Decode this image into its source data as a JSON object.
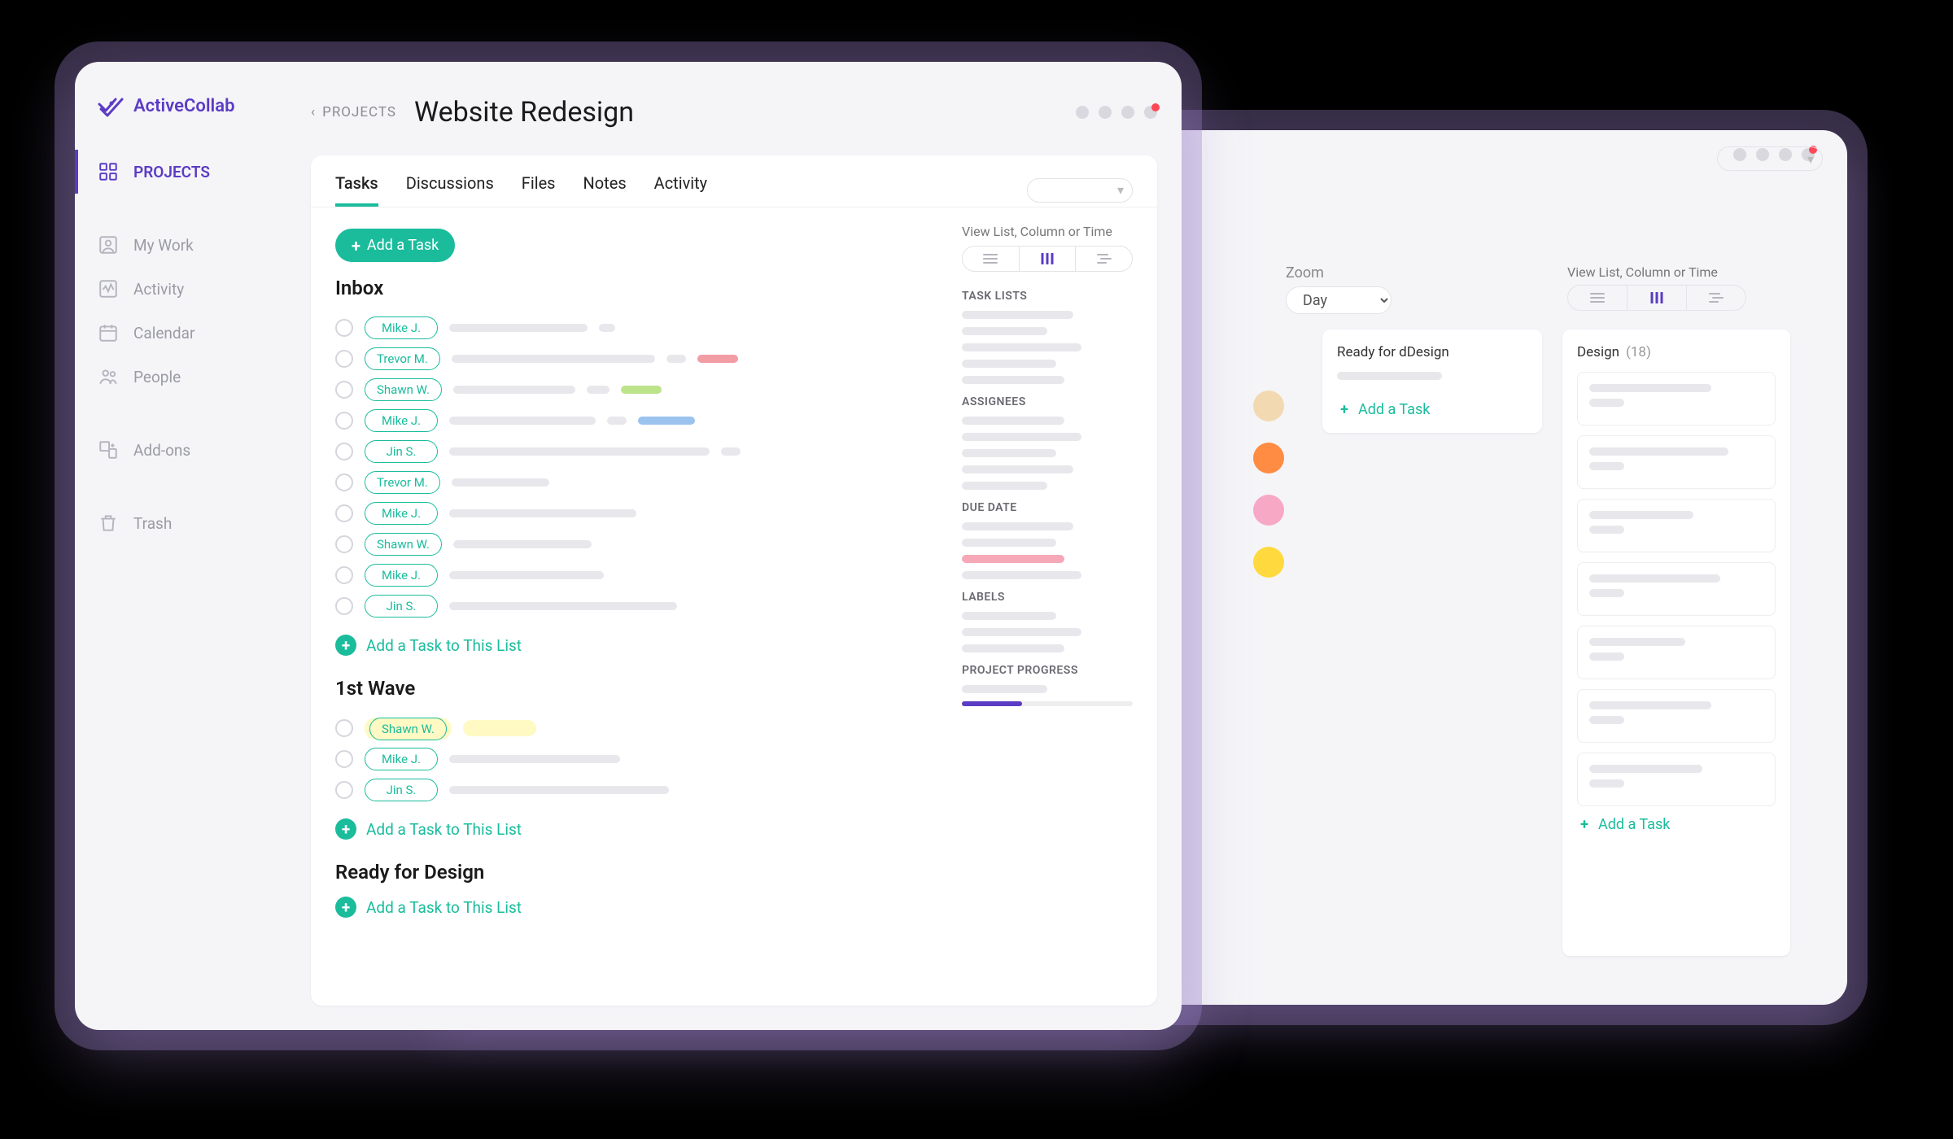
{
  "brand": "ActiveCollab",
  "breadcrumb": "PROJECTS",
  "page_title": "Website Redesign",
  "nav": {
    "projects": "PROJECTS",
    "mywork": "My Work",
    "activity": "Activity",
    "calendar": "Calendar",
    "people": "People",
    "addons": "Add-ons",
    "trash": "Trash"
  },
  "tabs": {
    "tasks": "Tasks",
    "discussions": "Discussions",
    "files": "Files",
    "notes": "Notes",
    "activity": "Activity"
  },
  "add_task_button": "Add a Task",
  "view_label": "View List, Column or Time",
  "add_to_list": "Add a Task to This List",
  "lists": {
    "inbox": "Inbox",
    "wave1": "1st Wave",
    "ready": "Ready for Design",
    "inbox_rows": [
      {
        "assignee": "Mike J."
      },
      {
        "assignee": "Trevor M."
      },
      {
        "assignee": "Shawn W."
      },
      {
        "assignee": "Mike J."
      },
      {
        "assignee": "Jin S."
      },
      {
        "assignee": "Trevor M."
      },
      {
        "assignee": "Mike J."
      },
      {
        "assignee": "Shawn W."
      },
      {
        "assignee": "Mike J."
      },
      {
        "assignee": "Jin S."
      }
    ],
    "wave1_rows": [
      {
        "assignee": "Shawn W."
      },
      {
        "assignee": "Mike J."
      },
      {
        "assignee": "Jin S."
      }
    ]
  },
  "side": {
    "task_lists": "TASK LISTS",
    "assignees": "ASSIGNEES",
    "due_date": "DUE DATE",
    "labels": "LABELS",
    "progress": "PROJECT PROGRESS"
  },
  "back": {
    "zoom_label": "Zoom",
    "zoom_value": "Day",
    "view_label": "View List, Column or Time",
    "col1_title": "Ready for dDesign",
    "col2_title": "Design",
    "col2_count": "(18)",
    "add_task": "Add a Task"
  }
}
